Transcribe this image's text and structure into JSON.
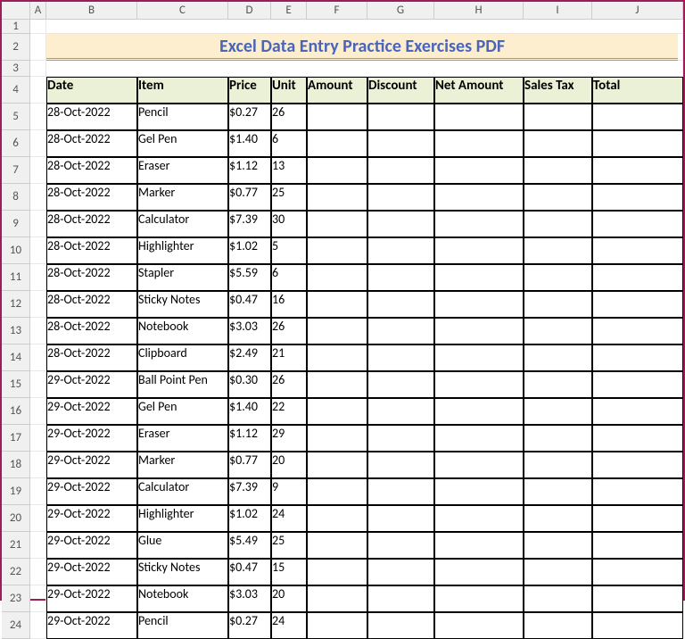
{
  "title": "Excel Data Entry Practice Exercises PDF",
  "columns": [
    "A",
    "B",
    "C",
    "D",
    "E",
    "F",
    "G",
    "H",
    "I",
    "J"
  ],
  "headers": {
    "date": "Date",
    "item": "Item",
    "price": "Price",
    "unit": "Unit",
    "amount": "Amount",
    "discount": "Discount",
    "netamount": "Net Amount",
    "salestax": "Sales Tax",
    "total": "Total"
  },
  "rows": [
    {
      "n": "5",
      "date": "28-Oct-2022",
      "item": "Pencil",
      "price": "$0.27",
      "unit": "26"
    },
    {
      "n": "6",
      "date": "28-Oct-2022",
      "item": "Gel Pen",
      "price": "$1.40",
      "unit": "6"
    },
    {
      "n": "7",
      "date": "28-Oct-2022",
      "item": "Eraser",
      "price": "$1.12",
      "unit": "13"
    },
    {
      "n": "8",
      "date": "28-Oct-2022",
      "item": "Marker",
      "price": "$0.77",
      "unit": "25"
    },
    {
      "n": "9",
      "date": "28-Oct-2022",
      "item": "Calculator",
      "price": "$7.39",
      "unit": "30"
    },
    {
      "n": "10",
      "date": "28-Oct-2022",
      "item": "Highlighter",
      "price": "$1.02",
      "unit": "5"
    },
    {
      "n": "11",
      "date": "28-Oct-2022",
      "item": "Stapler",
      "price": "$5.59",
      "unit": "6"
    },
    {
      "n": "12",
      "date": "28-Oct-2022",
      "item": "Sticky Notes",
      "price": "$0.47",
      "unit": "16"
    },
    {
      "n": "13",
      "date": "28-Oct-2022",
      "item": "Notebook",
      "price": "$3.03",
      "unit": "26"
    },
    {
      "n": "14",
      "date": "28-Oct-2022",
      "item": "Clipboard",
      "price": "$2.49",
      "unit": "21"
    },
    {
      "n": "15",
      "date": "29-Oct-2022",
      "item": "Ball Point Pen",
      "price": "$0.30",
      "unit": "26"
    },
    {
      "n": "16",
      "date": "29-Oct-2022",
      "item": "Gel Pen",
      "price": "$1.40",
      "unit": "22"
    },
    {
      "n": "17",
      "date": "29-Oct-2022",
      "item": "Eraser",
      "price": "$1.12",
      "unit": "29"
    },
    {
      "n": "18",
      "date": "29-Oct-2022",
      "item": "Marker",
      "price": "$0.77",
      "unit": "20"
    },
    {
      "n": "19",
      "date": "29-Oct-2022",
      "item": "Calculator",
      "price": "$7.39",
      "unit": "9"
    },
    {
      "n": "20",
      "date": "29-Oct-2022",
      "item": "Highlighter",
      "price": "$1.02",
      "unit": "24"
    },
    {
      "n": "21",
      "date": "29-Oct-2022",
      "item": "Glue",
      "price": "$5.49",
      "unit": "25"
    },
    {
      "n": "22",
      "date": "29-Oct-2022",
      "item": "Sticky Notes",
      "price": "$0.47",
      "unit": "15"
    },
    {
      "n": "23",
      "date": "29-Oct-2022",
      "item": "Notebook",
      "price": "$3.03",
      "unit": "20"
    },
    {
      "n": "24",
      "date": "29-Oct-2022",
      "item": "Pencil",
      "price": "$0.27",
      "unit": "24"
    }
  ],
  "rownums": {
    "r1": "1",
    "r2": "2",
    "r3": "3",
    "r4": "4"
  }
}
